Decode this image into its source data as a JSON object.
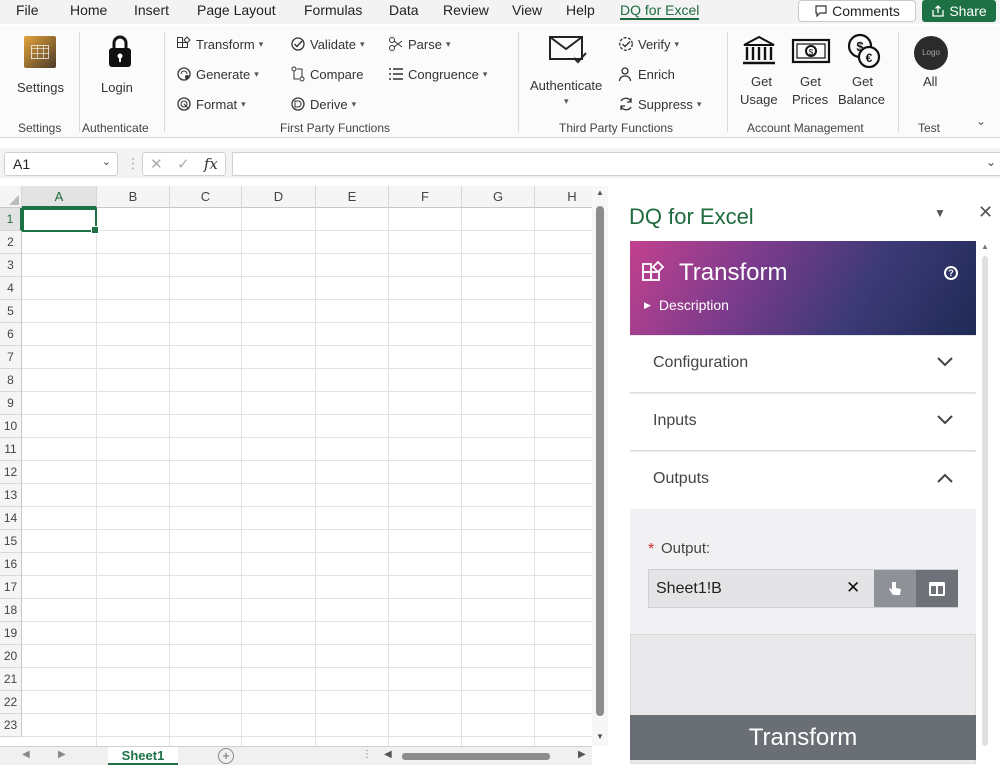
{
  "menu": {
    "items": [
      "File",
      "Home",
      "Insert",
      "Page Layout",
      "Formulas",
      "Data",
      "Review",
      "View",
      "Help",
      "DQ for Excel"
    ],
    "active": "DQ for Excel",
    "comments_label": "Comments",
    "share_label": "Share"
  },
  "ribbon": {
    "settings_label": "Settings",
    "login_label": "Login",
    "transform_label": "Transform",
    "generate_label": "Generate",
    "format_label": "Format",
    "validate_label": "Validate",
    "compare_label": "Compare",
    "derive_label": "Derive",
    "parse_label": "Parse",
    "congruence_label": "Congruence",
    "authenticate_label": "Authenticate",
    "verify_label": "Verify",
    "enrich_label": "Enrich",
    "suppress_label": "Suppress",
    "get_usage_line1": "Get",
    "get_usage_line2": "Usage",
    "get_prices_line1": "Get",
    "get_prices_line2": "Prices",
    "get_balance_line1": "Get",
    "get_balance_line2": "Balance",
    "logo_text": "Logo",
    "all_label": "All",
    "groups": {
      "settings": "Settings",
      "authenticate": "Authenticate",
      "first_party": "First Party Functions",
      "third_party": "Third Party Functions",
      "account": "Account Management",
      "test": "Test"
    }
  },
  "formula_bar": {
    "name_box": "A1",
    "fx_label": "fx",
    "formula": ""
  },
  "grid": {
    "columns": [
      "A",
      "B",
      "C",
      "D",
      "E",
      "F",
      "G",
      "H"
    ],
    "rows": [
      "1",
      "2",
      "3",
      "4",
      "5",
      "6",
      "7",
      "8",
      "9",
      "10",
      "11",
      "12",
      "13",
      "14",
      "15",
      "16",
      "17",
      "18",
      "19",
      "20",
      "21",
      "22",
      "23"
    ],
    "selected_cell": "A1"
  },
  "sheet_tabs": {
    "active": "Sheet1"
  },
  "panel": {
    "title": "DQ for Excel",
    "header_title": "Transform",
    "description_label": "Description",
    "sections": {
      "configuration": "Configuration",
      "inputs": "Inputs",
      "outputs": "Outputs"
    },
    "output_label": "Output:",
    "required_mark": "*",
    "output_value": "Sheet1!B",
    "action_button": "Transform",
    "colors": {
      "header_gradient_start": "#c2418f",
      "header_gradient_end": "#1f2a55",
      "accent_green": "#1e6b3e",
      "action_button_bg": "#6a6f76"
    }
  }
}
